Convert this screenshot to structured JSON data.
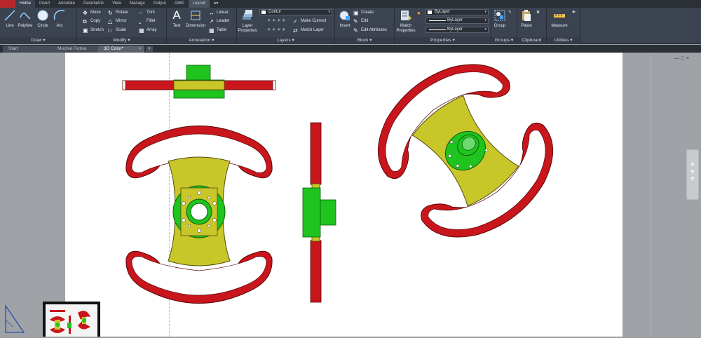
{
  "ribbon_tabs": [
    "Home",
    "Insert",
    "Annotate",
    "Parametric",
    "View",
    "Manage",
    "Output",
    "A360",
    "Layout"
  ],
  "active_ribbon_tab": "Home",
  "panels": {
    "draw": {
      "title": "Draw",
      "line": "Line",
      "polyline": "Polyline",
      "circle": "Circle",
      "arc": "Arc"
    },
    "modify": {
      "title": "Modify",
      "move": "Move",
      "rotate": "Rotate",
      "trim": "Trim",
      "copy": "Copy",
      "mirror": "Mirror",
      "fillet": "Fillet",
      "stretch": "Stretch",
      "scale": "Scale",
      "array": "Array"
    },
    "annotation": {
      "title": "Annotation",
      "text": "Text",
      "dimension": "Dimension",
      "linear": "Linear",
      "leader": "Leader",
      "table": "Table"
    },
    "layers": {
      "title": "Layers",
      "layer_properties": "Layer Properties",
      "current_layer": "Contur",
      "make_current": "Make Current",
      "match_layer": "Match Layer"
    },
    "block": {
      "title": "Block",
      "insert": "Insert",
      "create": "Create",
      "edit": "Edit",
      "edit_attributes": "Edit Attributes"
    },
    "properties": {
      "title": "Properties",
      "match_properties": "Match Properties",
      "color": "ByLayer",
      "linetype": "ByLayer",
      "lineweight": "ByLayer"
    },
    "groups": {
      "title": "Groups",
      "group": "Group"
    },
    "clipboard": {
      "title": "Clipboard",
      "paste": "Paste"
    },
    "utilities": {
      "title": "Utilities",
      "measure": "Measure"
    }
  },
  "doc_tabs": [
    {
      "label": "Start",
      "active": false
    },
    {
      "label": "Muchie Fictiva",
      "active": false
    },
    {
      "label": "3D Color*",
      "active": true
    }
  ],
  "colors": {
    "red": "#c8161c",
    "green": "#1fc41f",
    "yellow": "#c9c62a",
    "ribbon": "#3b4350",
    "accent": "#b8262b"
  }
}
